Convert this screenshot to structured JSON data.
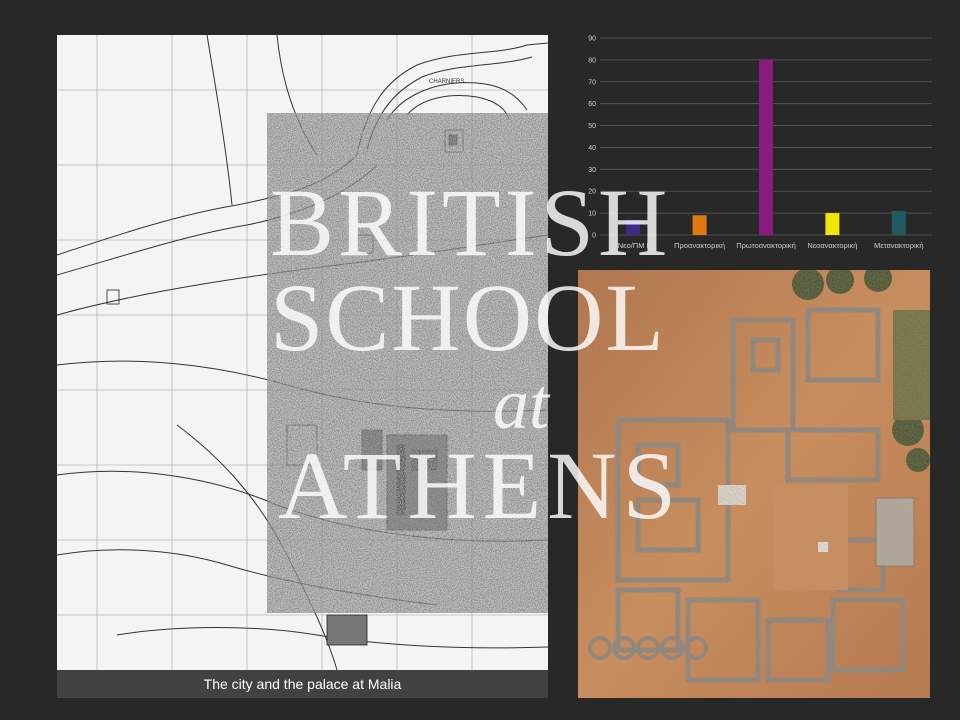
{
  "slide": {
    "caption": "The city and the palace at Malia",
    "map_label": "CHARNIERS"
  },
  "watermark": {
    "lines": [
      "BRITISH",
      "SCHOOL",
      "at",
      "ATHENS"
    ]
  },
  "chart_data": {
    "type": "bar",
    "categories": [
      "Νεο/ΠΜ Ι",
      "Προανακτορική",
      "Πρωτοανακτορική",
      "Νεοανακτορική",
      "Μετανακτορική"
    ],
    "values": [
      7,
      9,
      80,
      10,
      11
    ],
    "colors": [
      "#3d2a8a",
      "#e07a10",
      "#8b1a7e",
      "#f2e600",
      "#1f5a5e"
    ],
    "ylim": [
      0,
      90
    ],
    "yticks": [
      0,
      10,
      20,
      30,
      40,
      50,
      60,
      70,
      80,
      90
    ],
    "grid": true,
    "legend": "none"
  }
}
